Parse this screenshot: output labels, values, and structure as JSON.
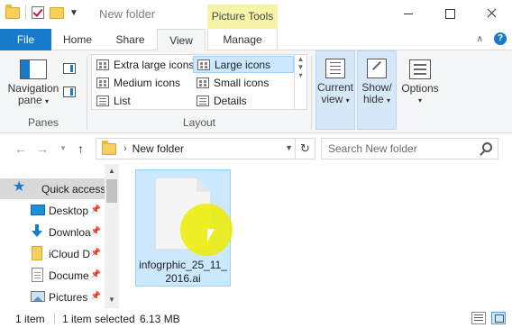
{
  "window": {
    "title": "New folder",
    "contextual_tab_group": "Picture Tools"
  },
  "ribbon_tabs": [
    {
      "label": "File"
    },
    {
      "label": "Home"
    },
    {
      "label": "Share"
    },
    {
      "label": "View"
    },
    {
      "label": "Manage"
    }
  ],
  "panes_group": {
    "navigation_pane_line1": "Navigation",
    "navigation_pane_line2": "pane",
    "label": "Panes"
  },
  "layout_group": {
    "label": "Layout",
    "items": [
      {
        "label": "Extra large icons"
      },
      {
        "label": "Large icons"
      },
      {
        "label": "Medium icons"
      },
      {
        "label": "Small icons"
      },
      {
        "label": "List"
      },
      {
        "label": "Details"
      }
    ]
  },
  "current_view": {
    "line1": "Current",
    "line2": "view"
  },
  "show_hide": {
    "line1": "Show/",
    "line2": "hide"
  },
  "options": {
    "label": "Options"
  },
  "address": {
    "path": "New folder",
    "search_placeholder": "Search New folder"
  },
  "nav_pane": {
    "items": [
      {
        "label": "Quick access"
      },
      {
        "label": "Desktop"
      },
      {
        "label": "Downloa"
      },
      {
        "label": "iCloud D"
      },
      {
        "label": "Docume"
      },
      {
        "label": "Pictures"
      }
    ]
  },
  "files": [
    {
      "name": "infogrphic_25_11_2016.ai"
    }
  ],
  "status": {
    "item_count": "1 item",
    "selection": "1 item selected",
    "size": "6.13 MB"
  },
  "colors": {
    "accent": "#1979ca",
    "selection": "#cce8ff",
    "contextual_tab": "#f7f4a8",
    "cursor_highlight": "#ecec00"
  }
}
